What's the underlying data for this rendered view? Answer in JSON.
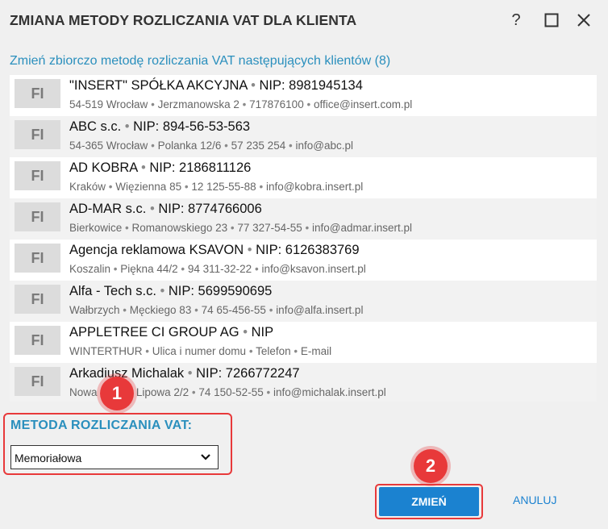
{
  "window": {
    "title": "ZMIANA METODY ROZLICZANIA VAT DLA KLIENTA",
    "help_label": "?"
  },
  "subtitle": "Zmień zbiorczo metodę rozliczania VAT następujących klientów (8)",
  "clients": [
    {
      "badge": "FI",
      "name": "\"INSERT\" SPÓŁKA AKCYJNA",
      "nip": "NIP: 8981945134",
      "postal": "54-519 Wrocław",
      "street": "Jerzmanowska 2",
      "phone": "717876100",
      "email": "office@insert.com.pl"
    },
    {
      "badge": "FI",
      "name": "ABC s.c.",
      "nip": "NIP: 894-56-53-563",
      "postal": "54-365 Wrocław",
      "street": "Polanka  12/6",
      "phone": "57 235 254",
      "email": "info@abc.pl"
    },
    {
      "badge": "FI",
      "name": "AD KOBRA",
      "nip": "NIP: 2186811126",
      "postal": "Kraków",
      "street": "Więzienna  85",
      "phone": "12 125-55-88",
      "email": "info@kobra.insert.pl"
    },
    {
      "badge": "FI",
      "name": "AD-MAR s.c.",
      "nip": "NIP: 8774766006",
      "postal": "Bierkowice",
      "street": "Romanowskiego 23",
      "phone": "77 327-54-55",
      "email": "info@admar.insert.pl"
    },
    {
      "badge": "FI",
      "name": "Agencja reklamowa KSAVON",
      "nip": "NIP: 6126383769",
      "postal": "Koszalin",
      "street": "Piękna  44/2",
      "phone": "94 311-32-22",
      "email": "info@ksavon.insert.pl"
    },
    {
      "badge": "FI",
      "name": "Alfa - Tech s.c.",
      "nip": "NIP: 5699590695",
      "postal": "Wałbrzych",
      "street": "Męckiego  83",
      "phone": "74 65-456-55",
      "email": "info@alfa.insert.pl"
    },
    {
      "badge": "FI",
      "name": "APPLETREE CI GROUP AG",
      "nip": "NIP",
      "postal": "WINTERTHUR",
      "street": "Ulica i numer domu",
      "phone": "Telefon",
      "email": "E-mail"
    },
    {
      "badge": "FI",
      "name": "Arkadiusz Michalak",
      "nip": "NIP: 7266772247",
      "postal": "Nowa Ruda",
      "street": "Lipowa  2/2",
      "phone": "74 150-52-55",
      "email": "info@michalak.insert.pl"
    }
  ],
  "separator": "•",
  "method": {
    "label": "METODA ROZLICZANIA VAT:",
    "selected": "Memoriałowa"
  },
  "buttons": {
    "change": "ZMIEŃ",
    "cancel": "ANULUJ"
  },
  "markers": [
    "1",
    "2"
  ],
  "colors": {
    "accent": "#2a8fbd",
    "primary_button": "#1b82d0",
    "highlight": "#e8393a"
  }
}
